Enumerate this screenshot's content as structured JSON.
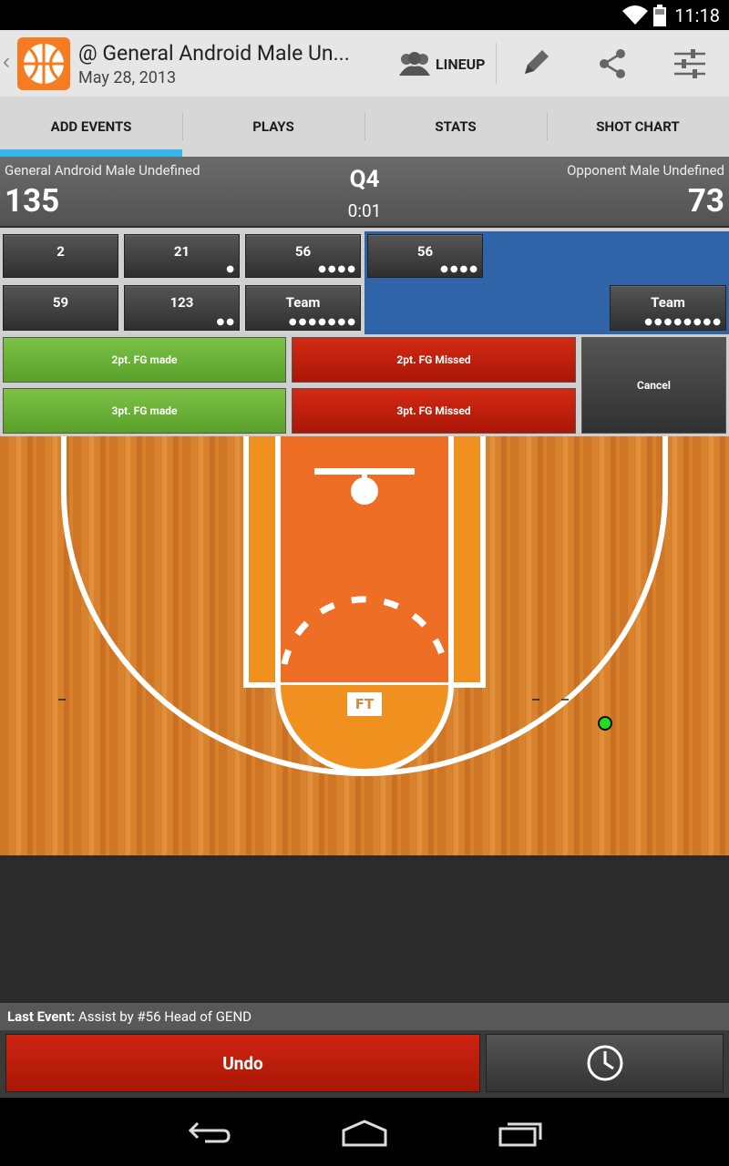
{
  "status_bar": {
    "time": "11:18"
  },
  "action_bar": {
    "title": "@ General Android Male Un...",
    "subtitle": "May 28, 2013",
    "lineup_label": "LINEUP"
  },
  "tabs": [
    {
      "label": "ADD EVENTS"
    },
    {
      "label": "PLAYS"
    },
    {
      "label": "STATS"
    },
    {
      "label": "SHOT CHART"
    }
  ],
  "scoreboard": {
    "home_name": "General Android Male Undefined",
    "home_score": "135",
    "away_name": "Opponent Male Undefined",
    "away_score": "73",
    "quarter": "Q4",
    "clock": "0:01"
  },
  "home_players": [
    {
      "label": "2",
      "dots": ""
    },
    {
      "label": "21",
      "dots": "●"
    },
    {
      "label": "56",
      "dots": "●●●●"
    },
    {
      "label": "59",
      "dots": ""
    },
    {
      "label": "123",
      "dots": "●●"
    },
    {
      "label": "Team",
      "dots": "●●●●●●●"
    }
  ],
  "away_players": [
    {
      "label": "56",
      "dots": "●●●●"
    },
    {
      "label": "Team",
      "dots": "●●●●●●●●"
    }
  ],
  "actions": {
    "made_2": "2pt. FG made",
    "missed_2": "2pt. FG Missed",
    "made_3": "3pt. FG made",
    "missed_3": "3pt. FG Missed",
    "cancel": "Cancel"
  },
  "court": {
    "ft_label": "FT",
    "shot_marker_color": "#22dd22"
  },
  "last_event": {
    "label": "Last Event:",
    "text": "Assist by #56 Head of GEND"
  },
  "bottom": {
    "undo_label": "Undo"
  },
  "colors": {
    "accent": "#33b5e5",
    "away_panel": "#2f64a8",
    "made": "#6cb33c",
    "missed": "#c21e0b"
  }
}
